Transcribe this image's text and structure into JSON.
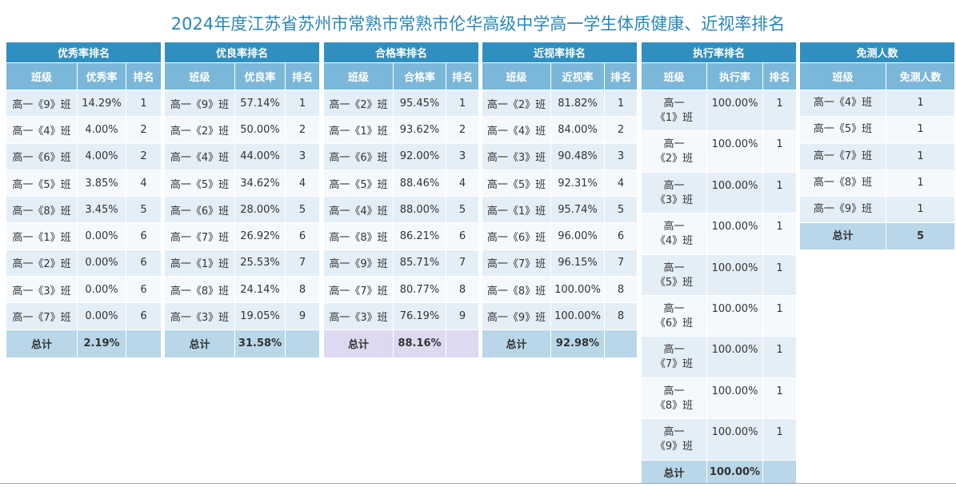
{
  "title": "2024年度江苏省苏州市常熟市常熟市伦华高级中学高一学生体质健康、近视率排名",
  "tables": [
    {
      "title": "优秀率排名",
      "headers": [
        "班级",
        "优秀率",
        "排名"
      ],
      "rows": [
        [
          "高一《9》班",
          "14.29%",
          "1"
        ],
        [
          "高一《4》班",
          "4.00%",
          "2"
        ],
        [
          "高一《6》班",
          "4.00%",
          "2"
        ],
        [
          "高一《5》班",
          "3.85%",
          "4"
        ],
        [
          "高一《8》班",
          "3.45%",
          "5"
        ],
        [
          "高一《1》班",
          "0.00%",
          "6"
        ],
        [
          "高一《2》班",
          "0.00%",
          "6"
        ],
        [
          "高一《3》班",
          "0.00%",
          "6"
        ],
        [
          "高一《7》班",
          "0.00%",
          "6"
        ]
      ],
      "total": [
        "总计",
        "2.19%",
        ""
      ]
    },
    {
      "title": "优良率排名",
      "headers": [
        "班级",
        "优良率",
        "排名"
      ],
      "rows": [
        [
          "高一《9》班",
          "57.14%",
          "1"
        ],
        [
          "高一《2》班",
          "50.00%",
          "2"
        ],
        [
          "高一《4》班",
          "44.00%",
          "3"
        ],
        [
          "高一《5》班",
          "34.62%",
          "4"
        ],
        [
          "高一《6》班",
          "28.00%",
          "5"
        ],
        [
          "高一《7》班",
          "26.92%",
          "6"
        ],
        [
          "高一《1》班",
          "25.53%",
          "7"
        ],
        [
          "高一《8》班",
          "24.14%",
          "8"
        ],
        [
          "高一《3》班",
          "19.05%",
          "9"
        ]
      ],
      "total": [
        "总计",
        "31.58%",
        ""
      ]
    },
    {
      "title": "合格率排名",
      "headers": [
        "班级",
        "合格率",
        "排名"
      ],
      "rows": [
        [
          "高一《2》班",
          "95.45%",
          "1"
        ],
        [
          "高一《1》班",
          "93.62%",
          "2"
        ],
        [
          "高一《6》班",
          "92.00%",
          "3"
        ],
        [
          "高一《5》班",
          "88.46%",
          "4"
        ],
        [
          "高一《4》班",
          "88.00%",
          "5"
        ],
        [
          "高一《8》班",
          "86.21%",
          "6"
        ],
        [
          "高一《9》班",
          "85.71%",
          "7"
        ],
        [
          "高一《7》班",
          "80.77%",
          "8"
        ],
        [
          "高一《3》班",
          "76.19%",
          "9"
        ]
      ],
      "total": [
        "总计",
        "88.16%",
        ""
      ]
    },
    {
      "title": "近视率排名",
      "headers": [
        "班级",
        "近视率",
        "排名"
      ],
      "rows": [
        [
          "高一《2》班",
          "81.82%",
          "1"
        ],
        [
          "高一《4》班",
          "84.00%",
          "2"
        ],
        [
          "高一《3》班",
          "90.48%",
          "3"
        ],
        [
          "高一《5》班",
          "92.31%",
          "4"
        ],
        [
          "高一《1》班",
          "95.74%",
          "5"
        ],
        [
          "高一《6》班",
          "96.00%",
          "6"
        ],
        [
          "高一《7》班",
          "96.15%",
          "7"
        ],
        [
          "高一《8》班",
          "100.00%",
          "8"
        ],
        [
          "高一《9》班",
          "100.00%",
          "8"
        ]
      ],
      "total": [
        "总计",
        "92.98%",
        ""
      ]
    },
    {
      "title": "执行率排名",
      "headers": [
        "班级",
        "执行率",
        "排名"
      ],
      "rows": [
        [
          "高一《1》班",
          "100.00%",
          "1"
        ],
        [
          "高一《2》班",
          "100.00%",
          "1"
        ],
        [
          "高一《3》班",
          "100.00%",
          "1"
        ],
        [
          "高一《4》班",
          "100.00%",
          "1"
        ],
        [
          "高一《5》班",
          "100.00%",
          "1"
        ],
        [
          "高一《6》班",
          "100.00%",
          "1"
        ],
        [
          "高一《7》班",
          "100.00%",
          "1"
        ],
        [
          "高一《8》班",
          "100.00%",
          "1"
        ],
        [
          "高一《9》班",
          "100.00%",
          "1"
        ]
      ],
      "total": [
        "总计",
        "100.00%",
        ""
      ]
    },
    {
      "title": "免测人数",
      "headers": [
        "班级",
        "免测人数"
      ],
      "rows": [
        [
          "高一《4》班",
          "1"
        ],
        [
          "高一《5》班",
          "1"
        ],
        [
          "高一《7》班",
          "1"
        ],
        [
          "高一《8》班",
          "1"
        ],
        [
          "高一《9》班",
          "1"
        ]
      ],
      "total": [
        "总计",
        "5"
      ]
    }
  ]
}
